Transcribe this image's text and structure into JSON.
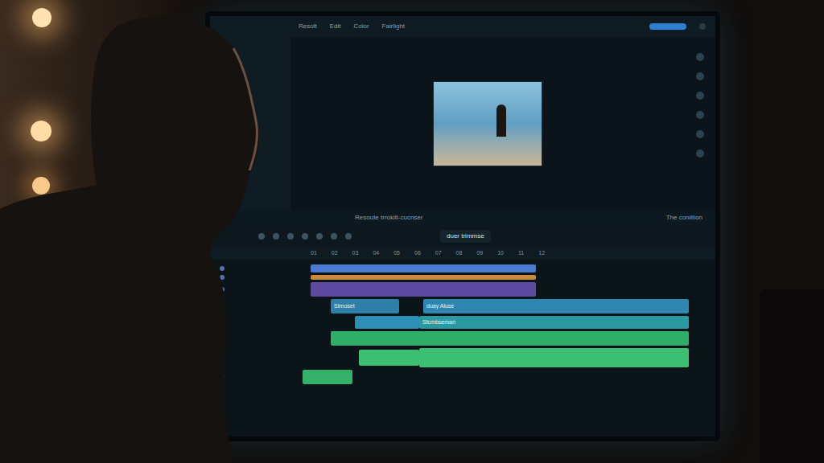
{
  "scene": {
    "kind": "photo",
    "subject": "person editing video at a monitor"
  },
  "editor": {
    "top_bar": [
      "Resolt",
      "Edit",
      "Color",
      "Fairlight"
    ],
    "preview_frame": {
      "kind": "photo"
    },
    "captions": {
      "left": "Resoute trrokilt-cucnser",
      "center": "duer trimmse",
      "right": "The coniition"
    },
    "ruler": [
      "01",
      "02",
      "03",
      "04",
      "05",
      "06",
      "07",
      "08",
      "09",
      "10",
      "11",
      "12"
    ],
    "tracks": [
      {
        "clips": [
          {
            "label": "",
            "color": "#4a7bd0"
          }
        ]
      },
      {
        "clips": [
          {
            "label": "",
            "color": "#c98a3c"
          }
        ]
      },
      {
        "clips": [
          {
            "label": "",
            "color": "#5b4a9e"
          }
        ]
      },
      {
        "clips": [
          {
            "label": "Stmoset",
            "color": "#2f7fa8"
          },
          {
            "label": "duay  Aluse",
            "color": "#2f86b0"
          }
        ]
      },
      {
        "clips": [
          {
            "label": "",
            "color": "#2d8fb5"
          },
          {
            "label": "Stcmbseman",
            "color": "#2a9aa0"
          }
        ]
      },
      {
        "clips": [
          {
            "label": "",
            "color": "#2fae6a"
          }
        ]
      },
      {
        "clips": [
          {
            "label": "",
            "color": "#3cbf72"
          },
          {
            "label": "",
            "color": "#3cbf72"
          }
        ]
      },
      {
        "clips": [
          {
            "label": "",
            "color": "#35b06a"
          }
        ]
      }
    ]
  }
}
